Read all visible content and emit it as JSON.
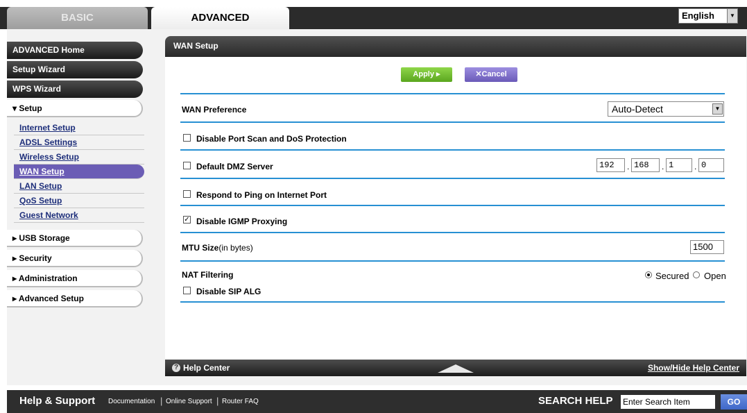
{
  "tabs": {
    "basic": "BASIC",
    "advanced": "ADVANCED"
  },
  "language": {
    "selected": "English"
  },
  "sidebar": {
    "advanced_home": "ADVANCED Home",
    "setup_wizard": "Setup Wizard",
    "wps_wizard": "WPS Wizard",
    "setup": "▾ Setup",
    "setup_items": [
      "Internet Setup",
      "ADSL Settings",
      "Wireless Setup",
      "WAN Setup",
      "LAN Setup",
      "QoS Setup",
      "Guest Network"
    ],
    "usb_storage": "▸ USB Storage",
    "security": "▸ Security",
    "administration": "▸ Administration",
    "advanced_setup": "▸ Advanced Setup"
  },
  "panel": {
    "title": "WAN Setup",
    "apply": "Apply ▸",
    "cancel": "✕Cancel",
    "wan_preference_label": "WAN Preference",
    "wan_preference_value": "Auto-Detect",
    "disable_port_scan": "Disable Port Scan and DoS Protection",
    "default_dmz": "Default DMZ Server",
    "dmz_ip": [
      "192",
      "168",
      "1",
      "0"
    ],
    "respond_ping": "Respond to Ping on Internet Port",
    "disable_igmp": "Disable IGMP Proxying",
    "mtu_label": "MTU Size",
    "mtu_unit": "(in bytes)",
    "mtu_value": "1500",
    "nat_filtering": "NAT Filtering",
    "nat_secured": "Secured",
    "nat_open": "Open",
    "disable_sip": "Disable SIP ALG",
    "help_center": "Help Center",
    "show_hide_help": "Show/Hide Help Center"
  },
  "footer": {
    "help_support": "Help & Support",
    "documentation": "Documentation",
    "online_support": "Online Support",
    "router_faq": "Router FAQ",
    "search_help": "SEARCH HELP",
    "search_placeholder": "Enter Search Item",
    "go": "GO"
  }
}
